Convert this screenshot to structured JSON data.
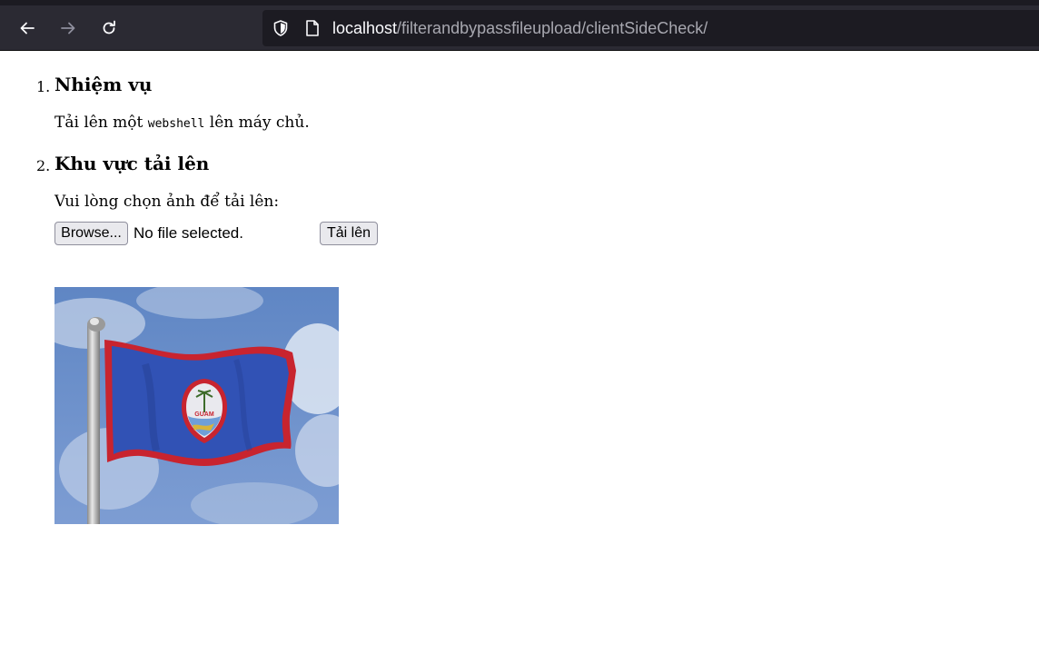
{
  "browser": {
    "url_host": "localhost",
    "url_path": "/filterandbypassfileupload/clientSideCheck/",
    "icons": [
      "back-arrow-icon",
      "forward-arrow-icon",
      "reload-icon",
      "shield-icon",
      "page-icon"
    ]
  },
  "page": {
    "sections": [
      {
        "marker": "1.",
        "heading": "Nhiệm vụ",
        "text_before": "Tải lên một ",
        "code": "webshell",
        "text_after": " lên máy chủ."
      },
      {
        "marker": "2.",
        "heading": "Khu vực tải lên",
        "prompt": "Vui lòng chọn ảnh để tải lên:"
      }
    ],
    "upload": {
      "browse_label": "Browse...",
      "file_status": "No file selected.",
      "submit_label": "Tải lên"
    },
    "preview_image": {
      "subject": "flag-of-guam",
      "seal_text": "GUAM"
    }
  }
}
